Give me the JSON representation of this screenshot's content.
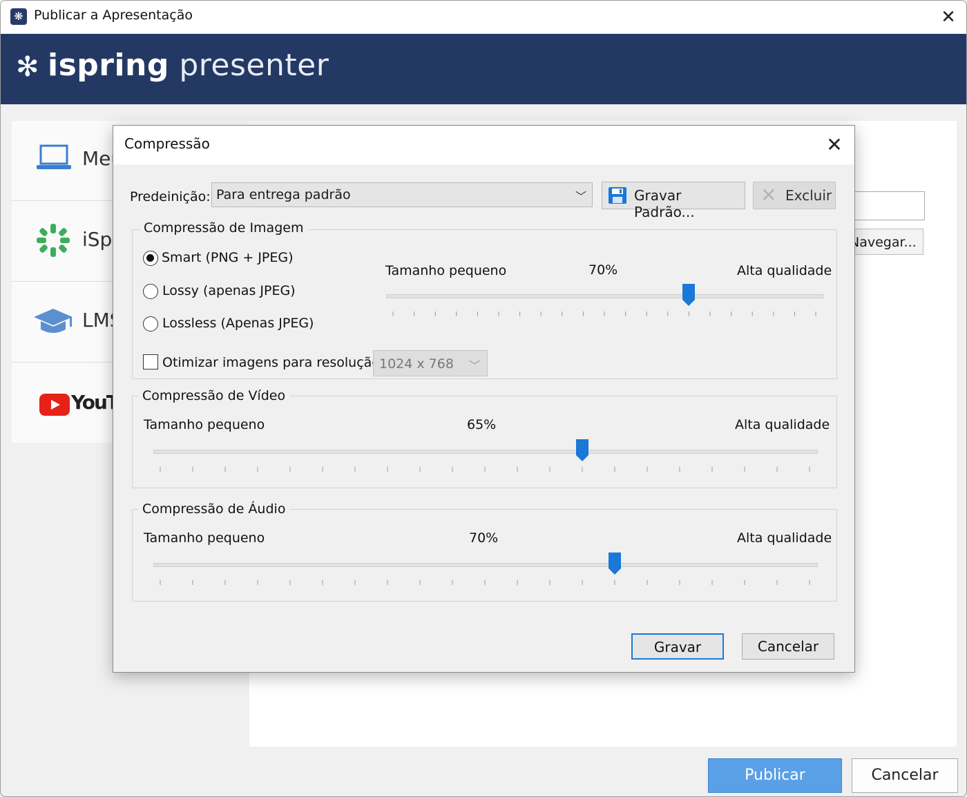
{
  "window": {
    "title": "Publicar a Apresentação",
    "close_glyph": "✕"
  },
  "banner": {
    "logo_bold": "ispring",
    "logo_light": " presenter",
    "logo_icon": "ispring-snowflake-icon"
  },
  "sidebar": {
    "items": [
      {
        "label": "Meu",
        "icon": "laptop-icon"
      },
      {
        "label": "iSpr",
        "icon": "ispring-logo-icon"
      },
      {
        "label": "LMS",
        "icon": "graduation-cap-icon"
      },
      {
        "label": "YouTu",
        "icon": "youtube-logo-icon"
      }
    ]
  },
  "background": {
    "browse_label": "Navegar...",
    "publish_label": "Publicar",
    "cancel_label": "Cancelar"
  },
  "dialog": {
    "title": "Compressão",
    "close_glyph": "✕",
    "preset": {
      "label": "Predeinição:",
      "value": "Para entrega padrão",
      "save_label": "Gravar Padrão...",
      "delete_label": "Excluir"
    },
    "image": {
      "title": "Compressão de Imagem",
      "options": [
        {
          "label": "Smart (PNG + JPEG)",
          "selected": true
        },
        {
          "label": "Lossy (apenas JPEG)",
          "selected": false
        },
        {
          "label": "Lossless (Apenas JPEG)",
          "selected": false
        }
      ],
      "slider": {
        "min_label": "Tamanho pequeno",
        "max_label": "Alta qualidade",
        "value_label": "70%",
        "value": 0.7
      },
      "optimize": {
        "label": "Otimizar imagens para resolução:",
        "checked": false,
        "resolution": "1024 x 768"
      }
    },
    "video": {
      "title": "Compressão de Vídeo",
      "slider": {
        "min_label": "Tamanho pequeno",
        "max_label": "Alta qualidade",
        "value_label": "65%",
        "value": 0.65
      }
    },
    "audio": {
      "title": "Compressão de Áudio",
      "slider": {
        "min_label": "Tamanho pequeno",
        "max_label": "Alta qualidade",
        "value_label": "70%",
        "value": 0.7
      }
    },
    "ok_label": "Gravar",
    "cancel_label": "Cancelar"
  },
  "colors": {
    "banner": "#243864",
    "accent": "#1a78d6",
    "slider_thumb": "#1a78d6"
  }
}
